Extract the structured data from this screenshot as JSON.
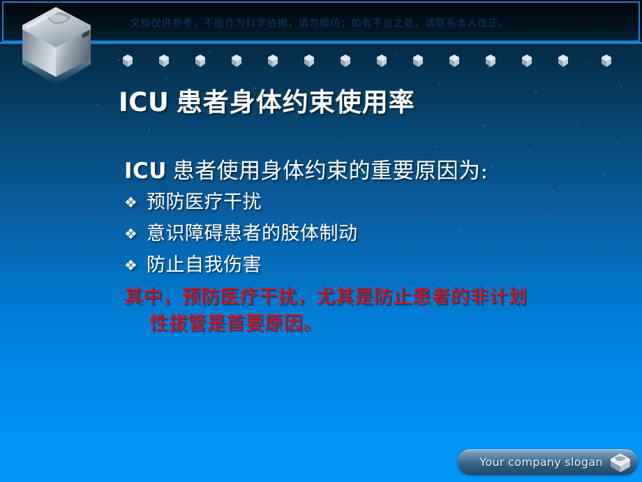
{
  "slide": {
    "disclaimer": "文档仅供参考，不能作为科学依据，请勿模仿；如有不当之处，请联系本人改正。",
    "title": {
      "latin": "ICU",
      "han": "患者身体约束使用率"
    },
    "subtitle": {
      "latin": "ICU",
      "han": "患者使用身体约束的重要原因为:"
    },
    "bullets": [
      {
        "marker": "❖",
        "text": "预防医疗干扰"
      },
      {
        "marker": "❖",
        "text": "意识障碍患者的肢体制动"
      },
      {
        "marker": "❖",
        "text": "防止自我伤害"
      }
    ],
    "emphasis": {
      "line1": "其中，预防医疗干扰，尤其是防止患者的非计划",
      "line2": "性拔管是首要原因。"
    }
  },
  "footer": {
    "slogan": "Your company slogan"
  },
  "colors": {
    "title_text": "#ffffff",
    "body_text": "#ffffff",
    "emphasis_text": "#ff0000",
    "disclaimer_text": "#0d3c68",
    "header_rule": "#1b7fcf",
    "background_top": "#03141f",
    "background_bottom": "#0096f8",
    "slogan_text": "#eaf2f8"
  },
  "decor": {
    "logo_cube": "chrome-cube",
    "mini_cube_count": 14,
    "slogan_cube": "chrome-cube-small"
  }
}
